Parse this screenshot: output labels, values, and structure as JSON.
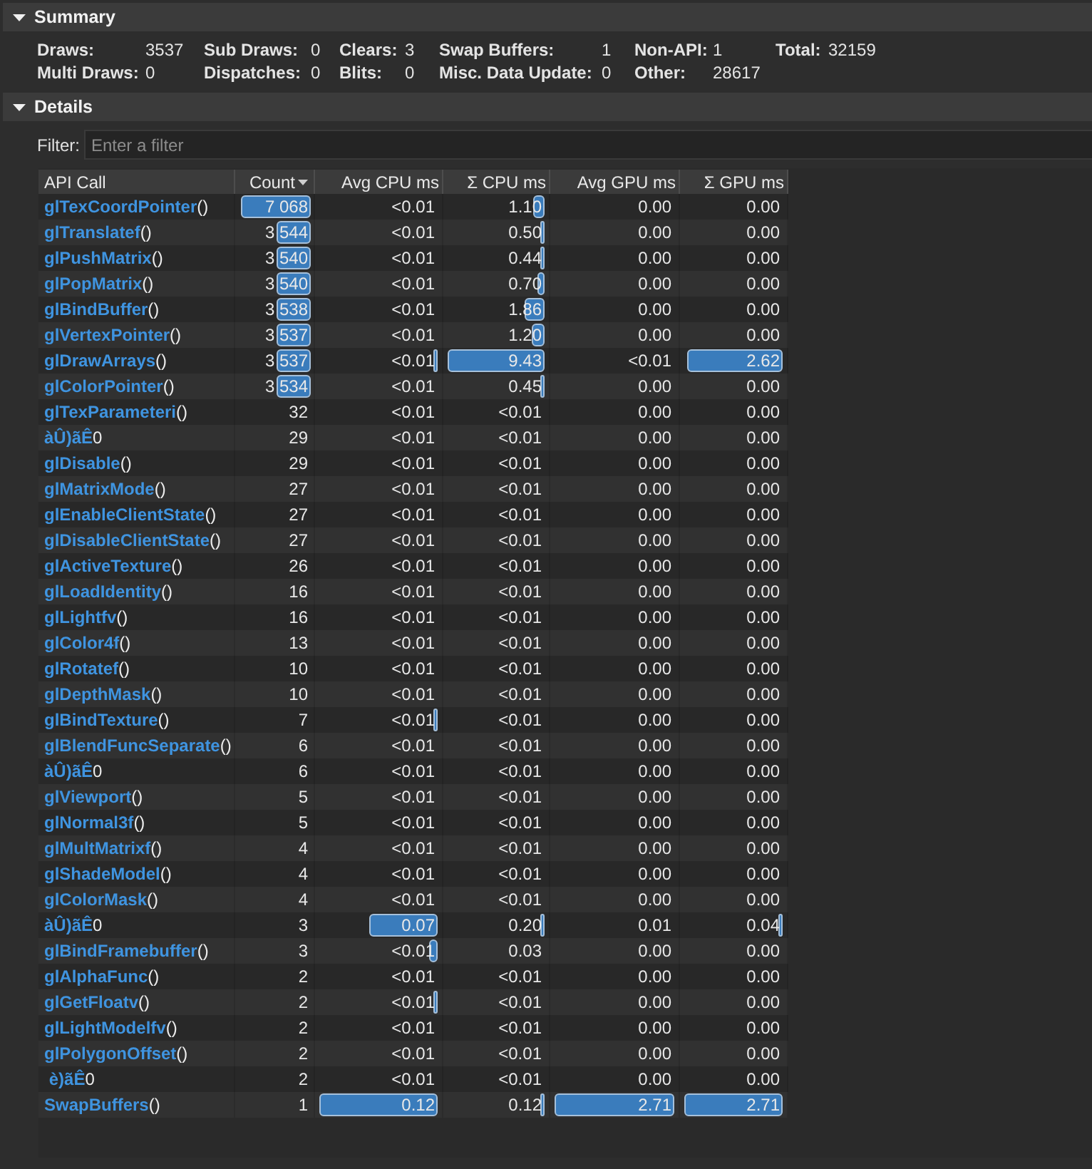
{
  "summary": {
    "title": "Summary",
    "expanded": true,
    "stats": [
      {
        "label": "Draws:",
        "value": "3537"
      },
      {
        "label": "Sub Draws:",
        "value": "0"
      },
      {
        "label": "Clears:",
        "value": "3"
      },
      {
        "label": "Swap Buffers:",
        "value": "1"
      },
      {
        "label": "Non-API:",
        "value": "1"
      },
      {
        "label": "Total:",
        "value": "32159"
      },
      {
        "label": "Multi Draws:",
        "value": "0"
      },
      {
        "label": "Dispatches:",
        "value": "0"
      },
      {
        "label": "Blits:",
        "value": "0"
      },
      {
        "label": "Misc. Data Update:",
        "value": "0"
      },
      {
        "label": "Other:",
        "value": "28617"
      }
    ]
  },
  "details": {
    "title": "Details",
    "expanded": true,
    "filter": {
      "label": "Filter:",
      "placeholder": "Enter a filter"
    },
    "table": {
      "columns": [
        {
          "label": "API Call",
          "sorted": false
        },
        {
          "label": "Count",
          "sorted": true
        },
        {
          "label": "Avg CPU ms",
          "sorted": false
        },
        {
          "label": "Σ CPU ms",
          "sorted": false
        },
        {
          "label": "Avg GPU ms",
          "sorted": false
        },
        {
          "label": "Σ GPU ms",
          "sorted": false
        }
      ],
      "rows": [
        {
          "cells": [
            {
              "text": "**glTexCoordPointer**()"
            },
            {
              "text": "7 068",
              "level": 1
            },
            {
              "text": "<0.01"
            },
            {
              "text": "1.10",
              "level": 0.12
            },
            {
              "text": "0.00"
            },
            {
              "text": "0.00"
            }
          ]
        },
        {
          "cells": [
            {
              "text": "**glTranslatef**()"
            },
            {
              "text": "3 544",
              "level": 0.5
            },
            {
              "text": "<0.01"
            },
            {
              "text": "0.50",
              "level": 0.05
            },
            {
              "text": "0.00"
            },
            {
              "text": "0.00"
            }
          ]
        },
        {
          "cells": [
            {
              "text": "**glPushMatrix**()"
            },
            {
              "text": "3 540",
              "level": 0.5
            },
            {
              "text": "<0.01"
            },
            {
              "text": "0.44",
              "level": 0.05
            },
            {
              "text": "0.00"
            },
            {
              "text": "0.00"
            }
          ]
        },
        {
          "cells": [
            {
              "text": "**glPopMatrix**()"
            },
            {
              "text": "3 540",
              "level": 0.5
            },
            {
              "text": "<0.01"
            },
            {
              "text": "0.70",
              "level": 0.07
            },
            {
              "text": "0.00"
            },
            {
              "text": "0.00"
            }
          ]
        },
        {
          "cells": [
            {
              "text": "**glBindBuffer**()"
            },
            {
              "text": "3 538",
              "level": 0.5
            },
            {
              "text": "<0.01"
            },
            {
              "text": "1.86",
              "level": 0.2
            },
            {
              "text": "0.00"
            },
            {
              "text": "0.00"
            }
          ]
        },
        {
          "cells": [
            {
              "text": "**glVertexPointer**()"
            },
            {
              "text": "3 537",
              "level": 0.5
            },
            {
              "text": "<0.01"
            },
            {
              "text": "1.20",
              "level": 0.13
            },
            {
              "text": "0.00"
            },
            {
              "text": "0.00"
            }
          ]
        },
        {
          "cells": [
            {
              "text": "**glDrawArrays**()"
            },
            {
              "text": "3 537",
              "level": 0.5
            },
            {
              "text": "<0.01",
              "level": 0.03
            },
            {
              "text": "9.43",
              "level": 1
            },
            {
              "text": "<0.01"
            },
            {
              "text": "2.62",
              "level": 0.97
            }
          ]
        },
        {
          "cells": [
            {
              "text": "**glColorPointer**()"
            },
            {
              "text": "3 534",
              "level": 0.5
            },
            {
              "text": "<0.01"
            },
            {
              "text": "0.45",
              "level": 0.05
            },
            {
              "text": "0.00"
            },
            {
              "text": "0.00"
            }
          ]
        },
        {
          "cells": [
            {
              "text": "**glTexParameteri**()"
            },
            {
              "text": "32"
            },
            {
              "text": "<0.01"
            },
            {
              "text": "<0.01"
            },
            {
              "text": "0.00"
            },
            {
              "text": "0.00"
            }
          ]
        },
        {
          "cells": [
            {
              "text": "**àÛ)ãÊ**0"
            },
            {
              "text": "29"
            },
            {
              "text": "<0.01"
            },
            {
              "text": "<0.01"
            },
            {
              "text": "0.00"
            },
            {
              "text": "0.00"
            }
          ]
        },
        {
          "cells": [
            {
              "text": "**glDisable**()"
            },
            {
              "text": "29"
            },
            {
              "text": "<0.01"
            },
            {
              "text": "<0.01"
            },
            {
              "text": "0.00"
            },
            {
              "text": "0.00"
            }
          ]
        },
        {
          "cells": [
            {
              "text": "**glMatrixMode**()"
            },
            {
              "text": "27"
            },
            {
              "text": "<0.01"
            },
            {
              "text": "<0.01"
            },
            {
              "text": "0.00"
            },
            {
              "text": "0.00"
            }
          ]
        },
        {
          "cells": [
            {
              "text": "**glEnableClientState**()"
            },
            {
              "text": "27"
            },
            {
              "text": "<0.01"
            },
            {
              "text": "<0.01"
            },
            {
              "text": "0.00"
            },
            {
              "text": "0.00"
            }
          ]
        },
        {
          "cells": [
            {
              "text": "**glDisableClientState**()"
            },
            {
              "text": "27"
            },
            {
              "text": "<0.01"
            },
            {
              "text": "<0.01"
            },
            {
              "text": "0.00"
            },
            {
              "text": "0.00"
            }
          ]
        },
        {
          "cells": [
            {
              "text": "**glActiveTexture**()"
            },
            {
              "text": "26"
            },
            {
              "text": "<0.01"
            },
            {
              "text": "<0.01"
            },
            {
              "text": "0.00"
            },
            {
              "text": "0.00"
            }
          ]
        },
        {
          "cells": [
            {
              "text": "**glLoadIdentity**()"
            },
            {
              "text": "16"
            },
            {
              "text": "<0.01"
            },
            {
              "text": "<0.01"
            },
            {
              "text": "0.00"
            },
            {
              "text": "0.00"
            }
          ]
        },
        {
          "cells": [
            {
              "text": "**glLightfv**()"
            },
            {
              "text": "16"
            },
            {
              "text": "<0.01"
            },
            {
              "text": "<0.01"
            },
            {
              "text": "0.00"
            },
            {
              "text": "0.00"
            }
          ]
        },
        {
          "cells": [
            {
              "text": "**glColor4f**()"
            },
            {
              "text": "13"
            },
            {
              "text": "<0.01"
            },
            {
              "text": "<0.01"
            },
            {
              "text": "0.00"
            },
            {
              "text": "0.00"
            }
          ]
        },
        {
          "cells": [
            {
              "text": "**glRotatef**()"
            },
            {
              "text": "10"
            },
            {
              "text": "<0.01"
            },
            {
              "text": "<0.01"
            },
            {
              "text": "0.00"
            },
            {
              "text": "0.00"
            }
          ]
        },
        {
          "cells": [
            {
              "text": "**glDepthMask**()"
            },
            {
              "text": "10"
            },
            {
              "text": "<0.01"
            },
            {
              "text": "<0.01"
            },
            {
              "text": "0.00"
            },
            {
              "text": "0.00"
            }
          ]
        },
        {
          "cells": [
            {
              "text": "**glBindTexture**()"
            },
            {
              "text": "7"
            },
            {
              "text": "<0.01",
              "level": 0.03
            },
            {
              "text": "<0.01"
            },
            {
              "text": "0.00"
            },
            {
              "text": "0.00"
            }
          ]
        },
        {
          "cells": [
            {
              "text": "**glBlendFuncSeparate**()"
            },
            {
              "text": "6"
            },
            {
              "text": "<0.01"
            },
            {
              "text": "<0.01"
            },
            {
              "text": "0.00"
            },
            {
              "text": "0.00"
            }
          ]
        },
        {
          "cells": [
            {
              "text": "**àÛ)ãÊ**0"
            },
            {
              "text": "6"
            },
            {
              "text": "<0.01"
            },
            {
              "text": "<0.01"
            },
            {
              "text": "0.00"
            },
            {
              "text": "0.00"
            }
          ]
        },
        {
          "cells": [
            {
              "text": "**glViewport**()"
            },
            {
              "text": "5"
            },
            {
              "text": "<0.01"
            },
            {
              "text": "<0.01"
            },
            {
              "text": "0.00"
            },
            {
              "text": "0.00"
            }
          ]
        },
        {
          "cells": [
            {
              "text": "**glNormal3f**()"
            },
            {
              "text": "5"
            },
            {
              "text": "<0.01"
            },
            {
              "text": "<0.01"
            },
            {
              "text": "0.00"
            },
            {
              "text": "0.00"
            }
          ]
        },
        {
          "cells": [
            {
              "text": "**glMultMatrixf**()"
            },
            {
              "text": "4"
            },
            {
              "text": "<0.01"
            },
            {
              "text": "<0.01"
            },
            {
              "text": "0.00"
            },
            {
              "text": "0.00"
            }
          ]
        },
        {
          "cells": [
            {
              "text": "**glShadeModel**()"
            },
            {
              "text": "4"
            },
            {
              "text": "<0.01"
            },
            {
              "text": "<0.01"
            },
            {
              "text": "0.00"
            },
            {
              "text": "0.00"
            }
          ]
        },
        {
          "cells": [
            {
              "text": "**glColorMask**()"
            },
            {
              "text": "4"
            },
            {
              "text": "<0.01"
            },
            {
              "text": "<0.01"
            },
            {
              "text": "0.00"
            },
            {
              "text": "0.00"
            }
          ]
        },
        {
          "cells": [
            {
              "text": "**àÛ)ãÊ**0"
            },
            {
              "text": "3"
            },
            {
              "text": "0.07",
              "level": 0.58
            },
            {
              "text": "0.20",
              "level": 0.02
            },
            {
              "text": "0.01"
            },
            {
              "text": "0.04",
              "level": 0.01
            }
          ]
        },
        {
          "cells": [
            {
              "text": "**glBindFramebuffer**()"
            },
            {
              "text": "3"
            },
            {
              "text": "<0.01",
              "level": 0.07
            },
            {
              "text": "0.03"
            },
            {
              "text": "0.00"
            },
            {
              "text": "0.00"
            }
          ]
        },
        {
          "cells": [
            {
              "text": "**glAlphaFunc**()"
            },
            {
              "text": "2"
            },
            {
              "text": "<0.01"
            },
            {
              "text": "<0.01"
            },
            {
              "text": "0.00"
            },
            {
              "text": "0.00"
            }
          ]
        },
        {
          "cells": [
            {
              "text": "**glGetFloatv**()"
            },
            {
              "text": "2"
            },
            {
              "text": "<0.01",
              "level": 0.03
            },
            {
              "text": "<0.01"
            },
            {
              "text": "0.00"
            },
            {
              "text": "0.00"
            }
          ]
        },
        {
          "cells": [
            {
              "text": "**glLightModelfv**()"
            },
            {
              "text": "2"
            },
            {
              "text": "<0.01"
            },
            {
              "text": "<0.01"
            },
            {
              "text": "0.00"
            },
            {
              "text": "0.00"
            }
          ]
        },
        {
          "cells": [
            {
              "text": "**glPolygonOffset**()"
            },
            {
              "text": "2"
            },
            {
              "text": "<0.01"
            },
            {
              "text": "<0.01"
            },
            {
              "text": "0.00"
            },
            {
              "text": "0.00"
            }
          ]
        },
        {
          "cells": [
            {
              "text": " **è)ãÊ**0"
            },
            {
              "text": "2"
            },
            {
              "text": "<0.01"
            },
            {
              "text": "<0.01"
            },
            {
              "text": "0.00"
            },
            {
              "text": "0.00"
            }
          ]
        },
        {
          "cells": [
            {
              "text": "**SwapBuffers**()"
            },
            {
              "text": "1"
            },
            {
              "text": "0.12",
              "level": 1
            },
            {
              "text": "0.12",
              "level": 0.01
            },
            {
              "text": "2.71",
              "level": 1
            },
            {
              "text": "2.71",
              "level": 1
            }
          ]
        }
      ]
    }
  }
}
